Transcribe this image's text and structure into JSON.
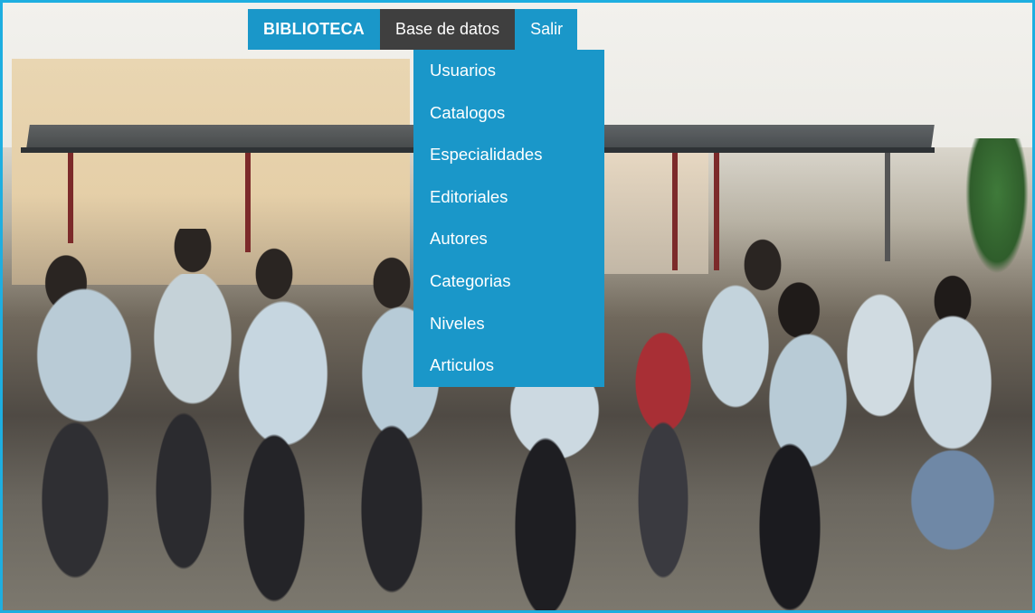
{
  "navbar": {
    "brand": "BIBLIOTECA",
    "items": [
      {
        "label": "Base de datos",
        "active": true
      },
      {
        "label": "Salir",
        "active": false
      }
    ]
  },
  "dropdown": {
    "items": [
      {
        "label": "Usuarios"
      },
      {
        "label": "Catalogos"
      },
      {
        "label": "Especialidades"
      },
      {
        "label": "Editoriales"
      },
      {
        "label": "Autores"
      },
      {
        "label": "Categorias"
      },
      {
        "label": "Niveles"
      },
      {
        "label": "Articulos"
      }
    ]
  },
  "colors": {
    "accent": "#1a97c9",
    "active_bg": "#3f3f3f",
    "frame_border": "#1eaee0",
    "text": "#ffffff"
  }
}
